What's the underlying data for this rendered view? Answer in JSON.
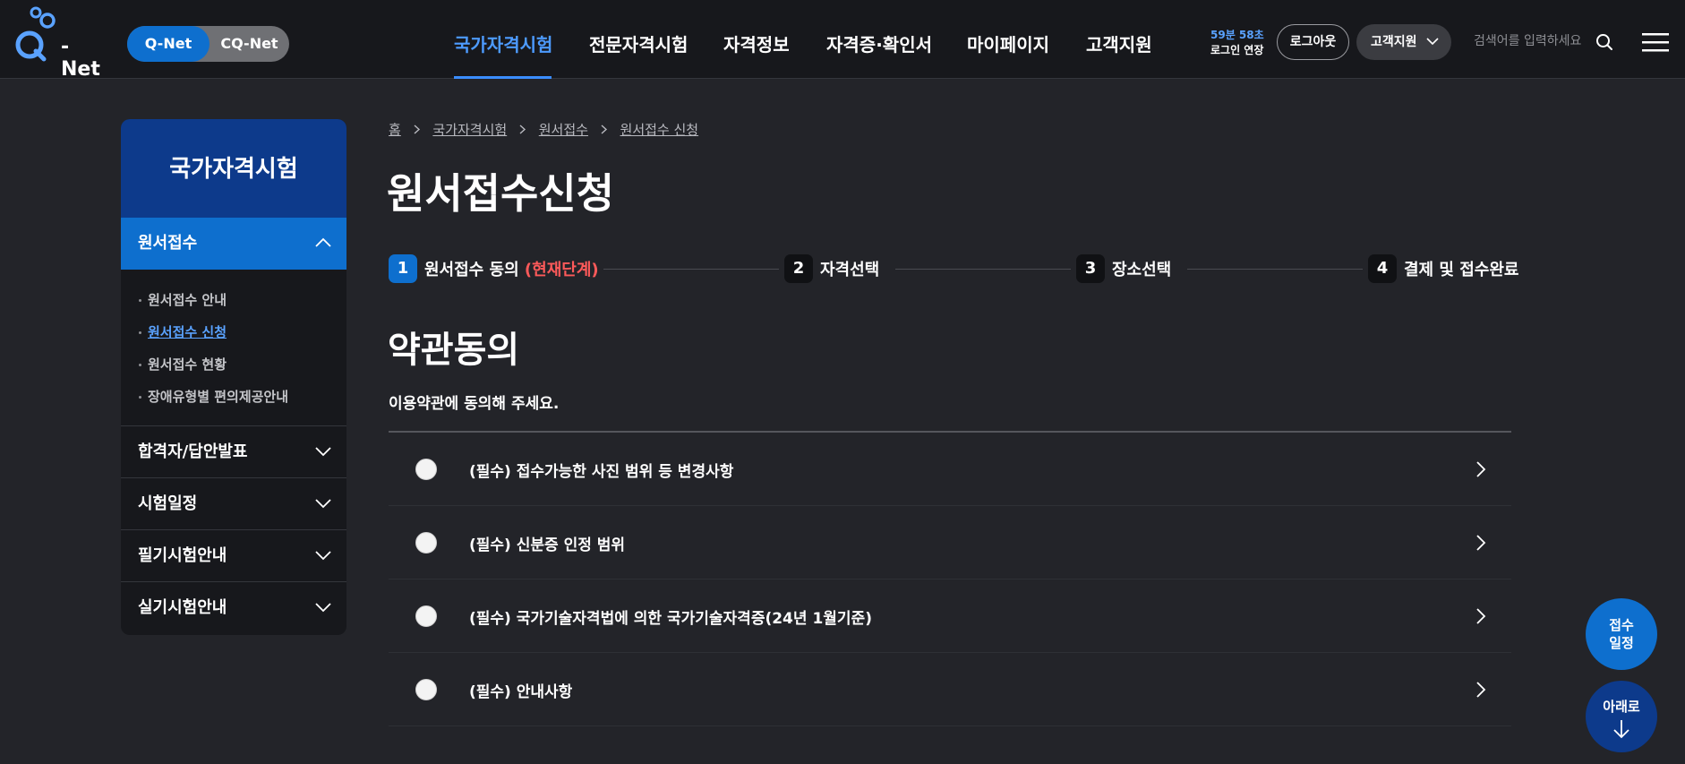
{
  "logo": {
    "text": "- Net"
  },
  "toggle": {
    "q_net": "Q-Net",
    "cq_net": "CQ-Net"
  },
  "gnb": [
    {
      "label": "국가자격시험",
      "active": true
    },
    {
      "label": "전문자격시험"
    },
    {
      "label": "자격정보"
    },
    {
      "label": "자격증·확인서"
    },
    {
      "label": "마이페이지"
    },
    {
      "label": "고객지원"
    }
  ],
  "header": {
    "timer_remaining": "59분 58초",
    "timer_extend": "로그인 연장",
    "logout_label": "로그아웃",
    "support_label": "고객지원",
    "search_placeholder": "검색어를 입력하세요"
  },
  "sidebar": {
    "title": "국가자격시험",
    "open_category": "원서접수",
    "sub_items": [
      {
        "label": "원서접수 안내"
      },
      {
        "label": "원서접수 신청",
        "current": true
      },
      {
        "label": "원서접수 현황"
      },
      {
        "label": "장애유형별 편의제공안내"
      }
    ],
    "categories": [
      {
        "label": "합격자/답안발표"
      },
      {
        "label": "시험일정"
      },
      {
        "label": "필기시험안내"
      },
      {
        "label": "실기시험안내"
      }
    ]
  },
  "breadcrumb": [
    "홈",
    "국가자격시험",
    "원서접수",
    "원서접수 신청"
  ],
  "page_title": "원서접수신청",
  "steps": [
    {
      "num": "1",
      "label": "원서접수 동의",
      "current_tag": "(현재단계)",
      "active": true
    },
    {
      "num": "2",
      "label": "자격선택"
    },
    {
      "num": "3",
      "label": "장소선택"
    },
    {
      "num": "4",
      "label": "결제 및 접수완료"
    }
  ],
  "section": {
    "title": "약관동의",
    "description": "이용약관에 동의해 주세요."
  },
  "terms": [
    {
      "label": "(필수) 접수가능한 사진 범위 등 변경사항"
    },
    {
      "label": "(필수) 신분증 인정 범위"
    },
    {
      "label": "(필수) 국가기술자격법에 의한 국가기술자격증(24년 1월기준)"
    },
    {
      "label": "(필수) 안내사항"
    }
  ],
  "floating": {
    "schedule_line1": "접수",
    "schedule_line2": "일정",
    "down_label": "아래로"
  },
  "colors": {
    "background": "#232429",
    "header": "#17181c",
    "accent_blue": "#0e6fce",
    "nav_active": "#4d9bff",
    "sidebar_head": "#0d3a8b",
    "current_step": "#ff5a5a"
  },
  "icons": [
    "q-net-logo-icon",
    "chevron-down-icon",
    "chevron-up-icon",
    "search-icon",
    "hamburger-menu-icon",
    "chevron-right-icon",
    "arrow-down-icon"
  ]
}
